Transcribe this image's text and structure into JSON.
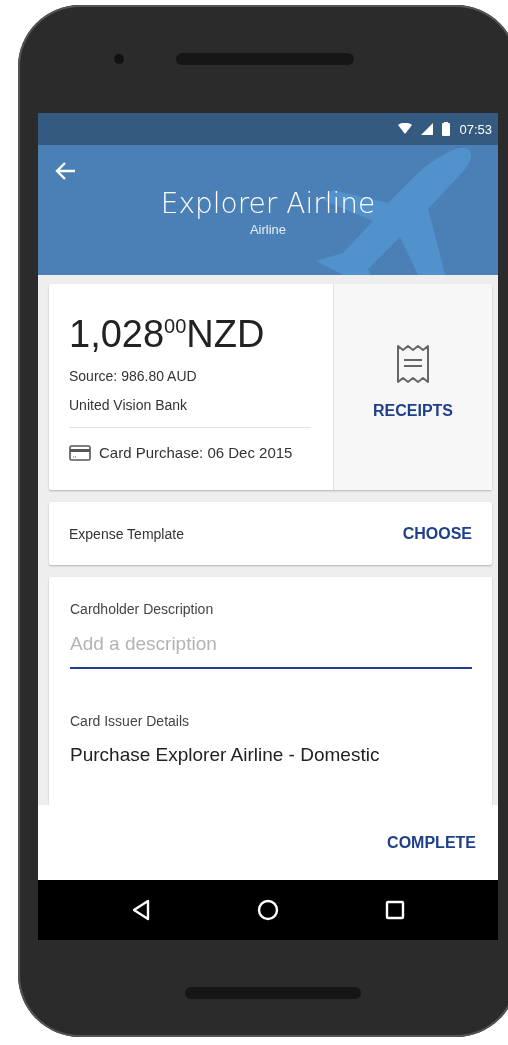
{
  "status_bar": {
    "time": "07:53"
  },
  "header": {
    "title": "Explorer Airline",
    "subtitle": "Airline"
  },
  "transaction": {
    "amount": "1,028$^{00}$NZD",
    "source": "Source: 986.80 AUD",
    "bank": "United Vision Bank",
    "purchase": "Card Purchase:  06 Dec 2015",
    "receipts_button": "RECEIPTS"
  },
  "expense_template": {
    "label": "Expense Template",
    "button": "CHOOSE"
  },
  "cardholder_description": {
    "label": "Cardholder Description",
    "placeholder": "Add a description"
  },
  "card_issuer_details": {
    "label": "Card Issuer Details",
    "value": "Purchase Explorer Airline - Domestic"
  },
  "footer": {
    "button": "COMPLETE"
  }
}
